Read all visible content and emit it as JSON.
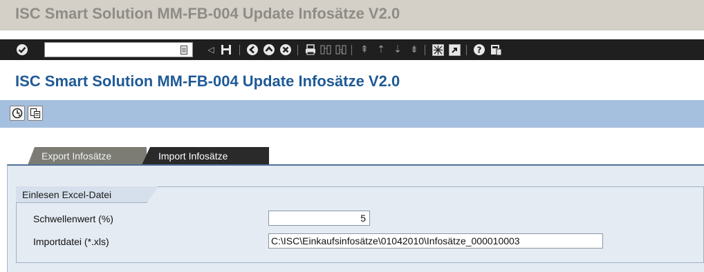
{
  "window": {
    "title": "ISC Smart Solution MM-FB-004 Update Infosätze V2.0"
  },
  "system_toolbar": {
    "command_field_value": "",
    "icons": [
      "enter-icon",
      "history-icon",
      "back-arrow-icon",
      "save-icon",
      "back-icon",
      "exit-icon",
      "cancel-icon",
      "print-icon",
      "find-icon",
      "find-next-icon",
      "first-page-icon",
      "previous-page-icon",
      "next-page-icon",
      "last-page-icon",
      "create-session-icon",
      "shortcut-icon",
      "help-icon",
      "layout-menu-icon"
    ]
  },
  "screen": {
    "title": "ISC Smart Solution MM-FB-004 Update Infosätze V2.0"
  },
  "app_toolbar": {
    "icons": [
      "execute-icon",
      "copy-icon"
    ]
  },
  "tabs": [
    {
      "label": "Export Infosätze",
      "active": false
    },
    {
      "label": "Import Infosätze",
      "active": true
    }
  ],
  "group": {
    "title": "Einlesen Excel-Datei",
    "fields": [
      {
        "label": "Schwellenwert (%)",
        "value": "5"
      },
      {
        "label": "Importdatei (*.xls)",
        "value": "C:\\ISC\\Einkaufsinfosätze\\01042010\\Infosätze_000010003"
      }
    ]
  },
  "colors": {
    "titlebar_bg": "#d4d0c8",
    "title_gray": "#8e8c86",
    "toolbar_bg": "#1f1f1f",
    "screen_title": "#1f5a96",
    "app_toolbar_bg": "#a5bfdf",
    "active_tab": "#2a2a2a",
    "inactive_tab": "#7c7c74",
    "panel_bg": "#e5ebf3"
  }
}
